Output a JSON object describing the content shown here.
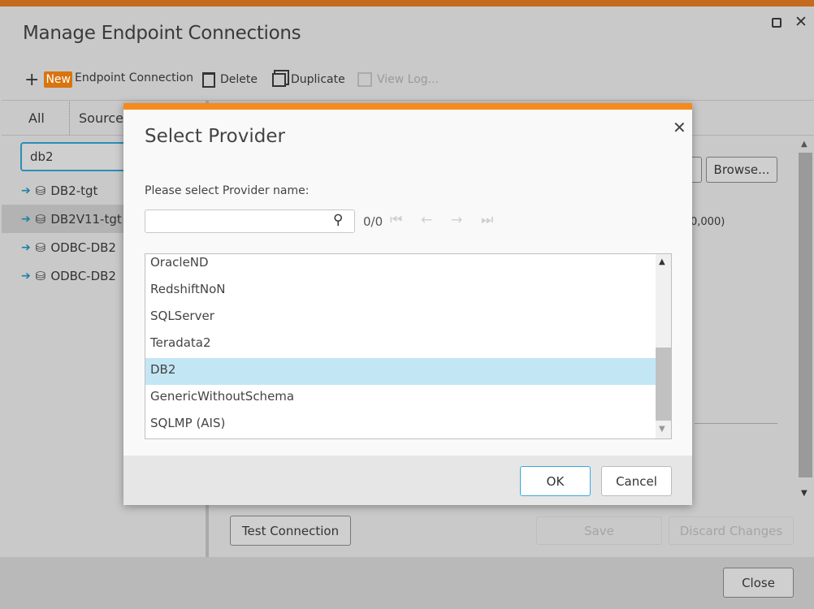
{
  "window": {
    "title": "Manage Endpoint Connections"
  },
  "toolbar": {
    "new_badge": "New",
    "new_label": "Endpoint Connection",
    "delete": "Delete",
    "duplicate": "Duplicate",
    "view_log": "View Log..."
  },
  "tabs": [
    {
      "label": "All"
    },
    {
      "label": "Sources"
    }
  ],
  "sidebar": {
    "search_value": "db2",
    "items": [
      {
        "label": "DB2-tgt"
      },
      {
        "label": "DB2V11-tgt"
      },
      {
        "label": "ODBC-DB2"
      },
      {
        "label": "ODBC-DB2"
      }
    ]
  },
  "right": {
    "browse": "Browse...",
    "partial_text": "0,000)"
  },
  "bottom": {
    "test_connection": "Test Connection",
    "save": "Save",
    "discard": "Discard Changes",
    "close": "Close"
  },
  "dialog": {
    "title": "Select Provider",
    "label": "Please select Provider name:",
    "search_placeholder": "",
    "count": "0/0",
    "providers": [
      {
        "label": "OracleND"
      },
      {
        "label": "RedshiftNoN"
      },
      {
        "label": "SQLServer"
      },
      {
        "label": "Teradata2"
      },
      {
        "label": "DB2"
      },
      {
        "label": "GenericWithoutSchema"
      },
      {
        "label": "SQLMP (AIS)"
      }
    ],
    "selected": "DB2",
    "ok": "OK",
    "cancel": "Cancel"
  },
  "colors": {
    "accent": "#f58a1f",
    "selection": "#c3e6f5",
    "focus": "#2a8fb8"
  }
}
